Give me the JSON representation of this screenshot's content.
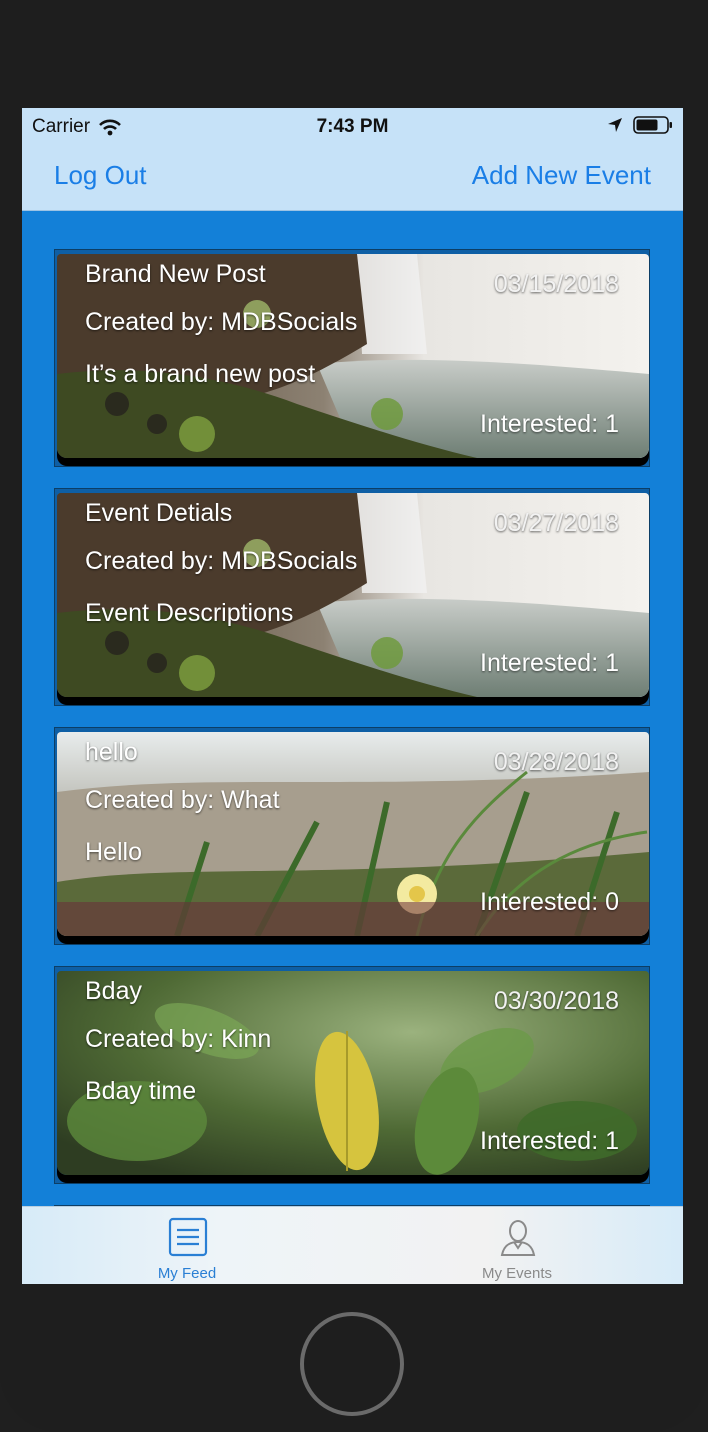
{
  "status_bar": {
    "carrier": "Carrier",
    "time": "7:43 PM"
  },
  "nav": {
    "left_button": "Log Out",
    "right_button": "Add New Event"
  },
  "events": [
    {
      "title": "Brand New Post",
      "creator": "Created by: MDBSocials",
      "description": "It’s a brand new post",
      "date": "03/15/2018",
      "interested": "Interested: 1",
      "image": "waterfall"
    },
    {
      "title": "Event Detials",
      "creator": "Created by: MDBSocials",
      "description": "Event Descriptions",
      "date": "03/27/2018",
      "interested": "Interested: 1",
      "image": "waterfall"
    },
    {
      "title": "hello",
      "creator": "Created by: What",
      "description": "Hello",
      "date": "03/28/2018",
      "interested": "Interested: 0",
      "image": "beach-plants"
    },
    {
      "title": "Bday",
      "creator": "Created by: Kinn",
      "description": "Bday time",
      "date": "03/30/2018",
      "interested": "Interested: 1",
      "image": "leaves"
    }
  ],
  "tab_bar": {
    "tabs": [
      {
        "label": "My Feed",
        "icon": "list-icon",
        "active": true
      },
      {
        "label": "My Events",
        "icon": "person-icon",
        "active": false
      }
    ]
  },
  "colors": {
    "accent": "#1a7ee6",
    "feed_background": "#1380d8",
    "nav_background": "#c6e2f8"
  }
}
